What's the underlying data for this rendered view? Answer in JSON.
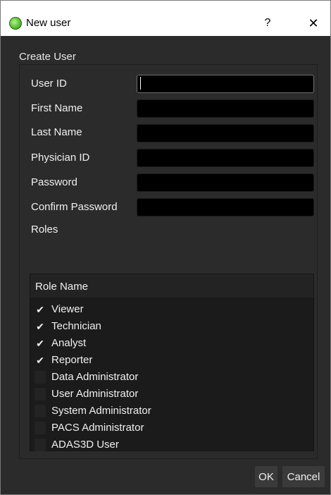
{
  "window": {
    "title": "New user",
    "help_label": "?",
    "close_label": "✕",
    "icon": "app-logo-green-circle"
  },
  "form": {
    "group_title": "Create User",
    "fields": {
      "user_id": {
        "label": "User ID",
        "value": ""
      },
      "first_name": {
        "label": "First Name",
        "value": ""
      },
      "last_name": {
        "label": "Last Name",
        "value": ""
      },
      "physician_id": {
        "label": "Physician ID",
        "value": ""
      },
      "password": {
        "label": "Password",
        "value": ""
      },
      "confirm_password": {
        "label": "Confirm Password",
        "value": ""
      }
    },
    "roles_label": "Roles"
  },
  "roles_table": {
    "column_header": "Role Name",
    "rows": [
      {
        "name": "Viewer",
        "checked": true,
        "mark": "✔"
      },
      {
        "name": "Technician",
        "checked": true,
        "mark": "✔"
      },
      {
        "name": "Analyst",
        "checked": true,
        "mark": "✔"
      },
      {
        "name": "Reporter",
        "checked": true,
        "mark": "✔"
      },
      {
        "name": "Data Administrator",
        "checked": false,
        "mark": ""
      },
      {
        "name": "User Administrator",
        "checked": false,
        "mark": ""
      },
      {
        "name": "System Administrator",
        "checked": false,
        "mark": ""
      },
      {
        "name": "PACS Administrator",
        "checked": false,
        "mark": ""
      },
      {
        "name": "ADAS3D User",
        "checked": false,
        "mark": ""
      }
    ]
  },
  "buttons": {
    "ok": "OK",
    "cancel": "Cancel"
  },
  "colors": {
    "dialog_background": "#2b2b2b",
    "input_background": "#000000",
    "table_background": "#1b1b1b",
    "text": "#f0f0f0"
  }
}
